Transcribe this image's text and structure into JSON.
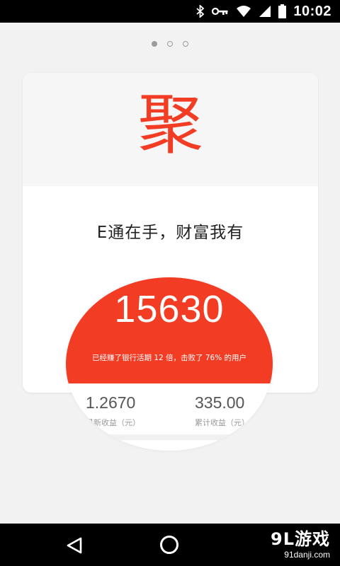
{
  "status_bar": {
    "time": "10:02",
    "icons": [
      "bluetooth-icon",
      "vpn-key-icon",
      "wifi-icon",
      "cell-signal-icon",
      "battery-icon"
    ]
  },
  "pager": {
    "count": 3,
    "active_index": 0
  },
  "card": {
    "glyph": "聚",
    "slogan": "E通在手，财富我有"
  },
  "magnifier": {
    "main_number": "15630",
    "description": "已经赚了银行活期 12 倍，击败了 76% 的用户",
    "stats": [
      {
        "value": "1.2670",
        "label": "最新收益（元）"
      },
      {
        "value": "335.00",
        "label": "累计收益（元）"
      }
    ]
  },
  "nav_bar": {
    "watermark_logo": "9L游戏",
    "watermark_url": "91danji.com"
  },
  "colors": {
    "accent_red": "#f23c24",
    "background": "#f2f2f2",
    "card_top": "#f6f6f6"
  }
}
